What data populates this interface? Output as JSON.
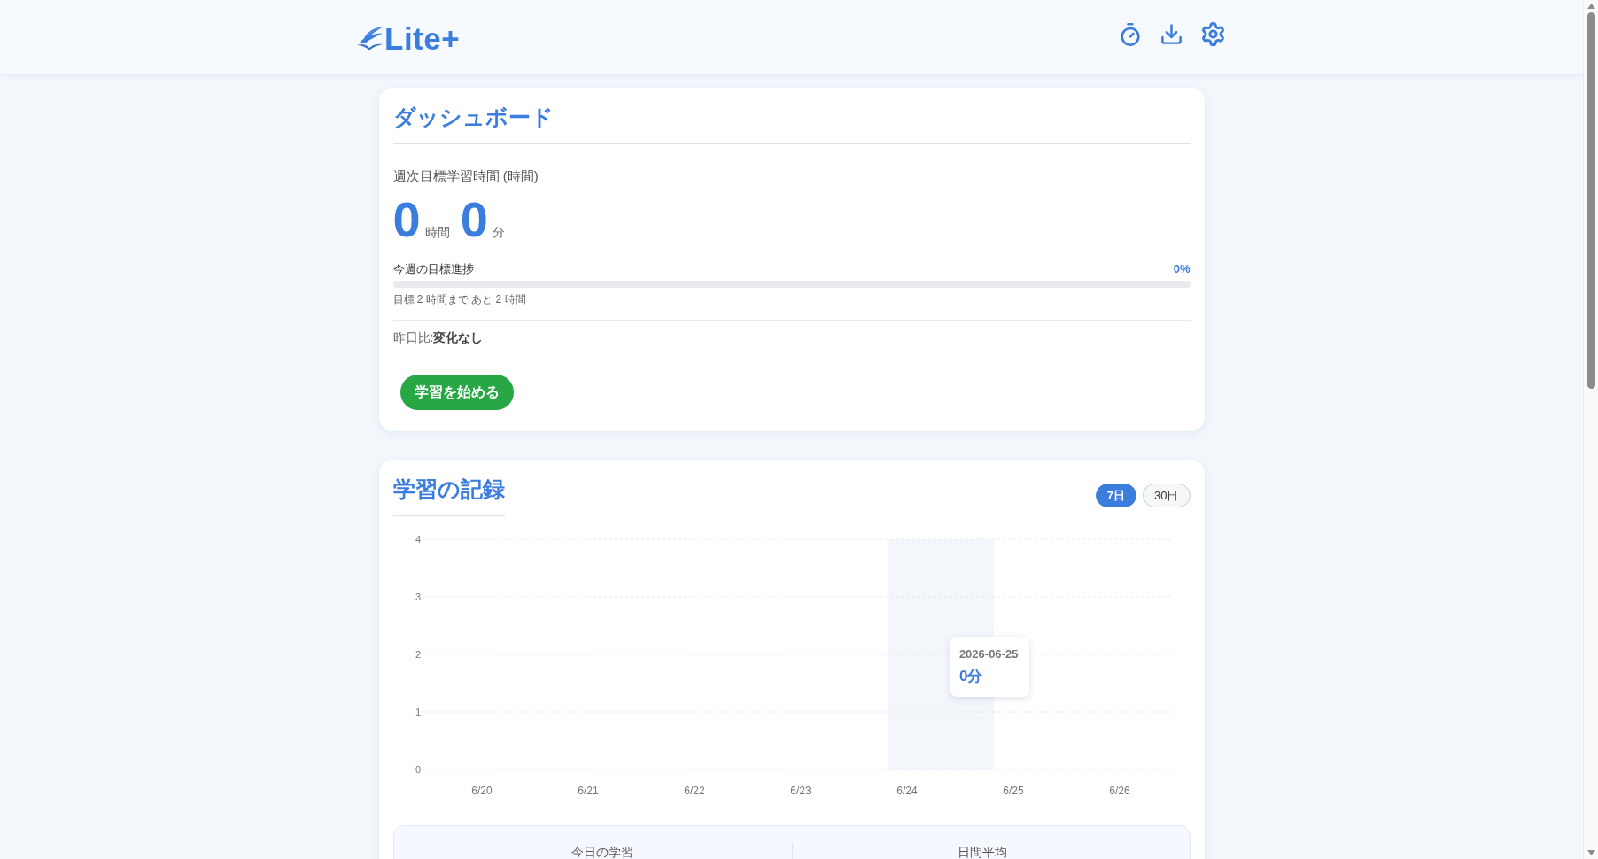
{
  "header": {
    "logo": "Lite+"
  },
  "dashboard": {
    "title": "ダッシュボード",
    "goal_label": "週次目標学習時間 (時間)",
    "hours": "0",
    "hours_unit": "時間",
    "minutes": "0",
    "minutes_unit": "分",
    "progress": {
      "label": "今週の目標進捗",
      "percent": "0%",
      "level": 0,
      "note": "目標 2 時間まで あと 2 時間"
    },
    "comparison": "昨日比:**変化なし**",
    "start_button": "学習を始める"
  },
  "history": {
    "title": "学習の記録",
    "ranges": [
      {
        "label": "7日",
        "selected": true
      },
      {
        "label": "30日",
        "selected": false
      }
    ],
    "chart_data": {
      "type": "bar",
      "categories": [
        "6/20",
        "6/21",
        "6/22",
        "6/23",
        "6/24",
        "6/25",
        "6/26"
      ],
      "values": [
        0,
        0,
        0,
        0,
        0,
        0,
        0
      ],
      "ylim": [
        0,
        4
      ],
      "yticks": [
        0,
        1,
        2,
        3,
        4
      ],
      "grid": true
    },
    "tooltip": {
      "title": "2026-06-25",
      "value": "0分"
    },
    "summary": [
      "今日の学習",
      "日間平均"
    ]
  }
}
